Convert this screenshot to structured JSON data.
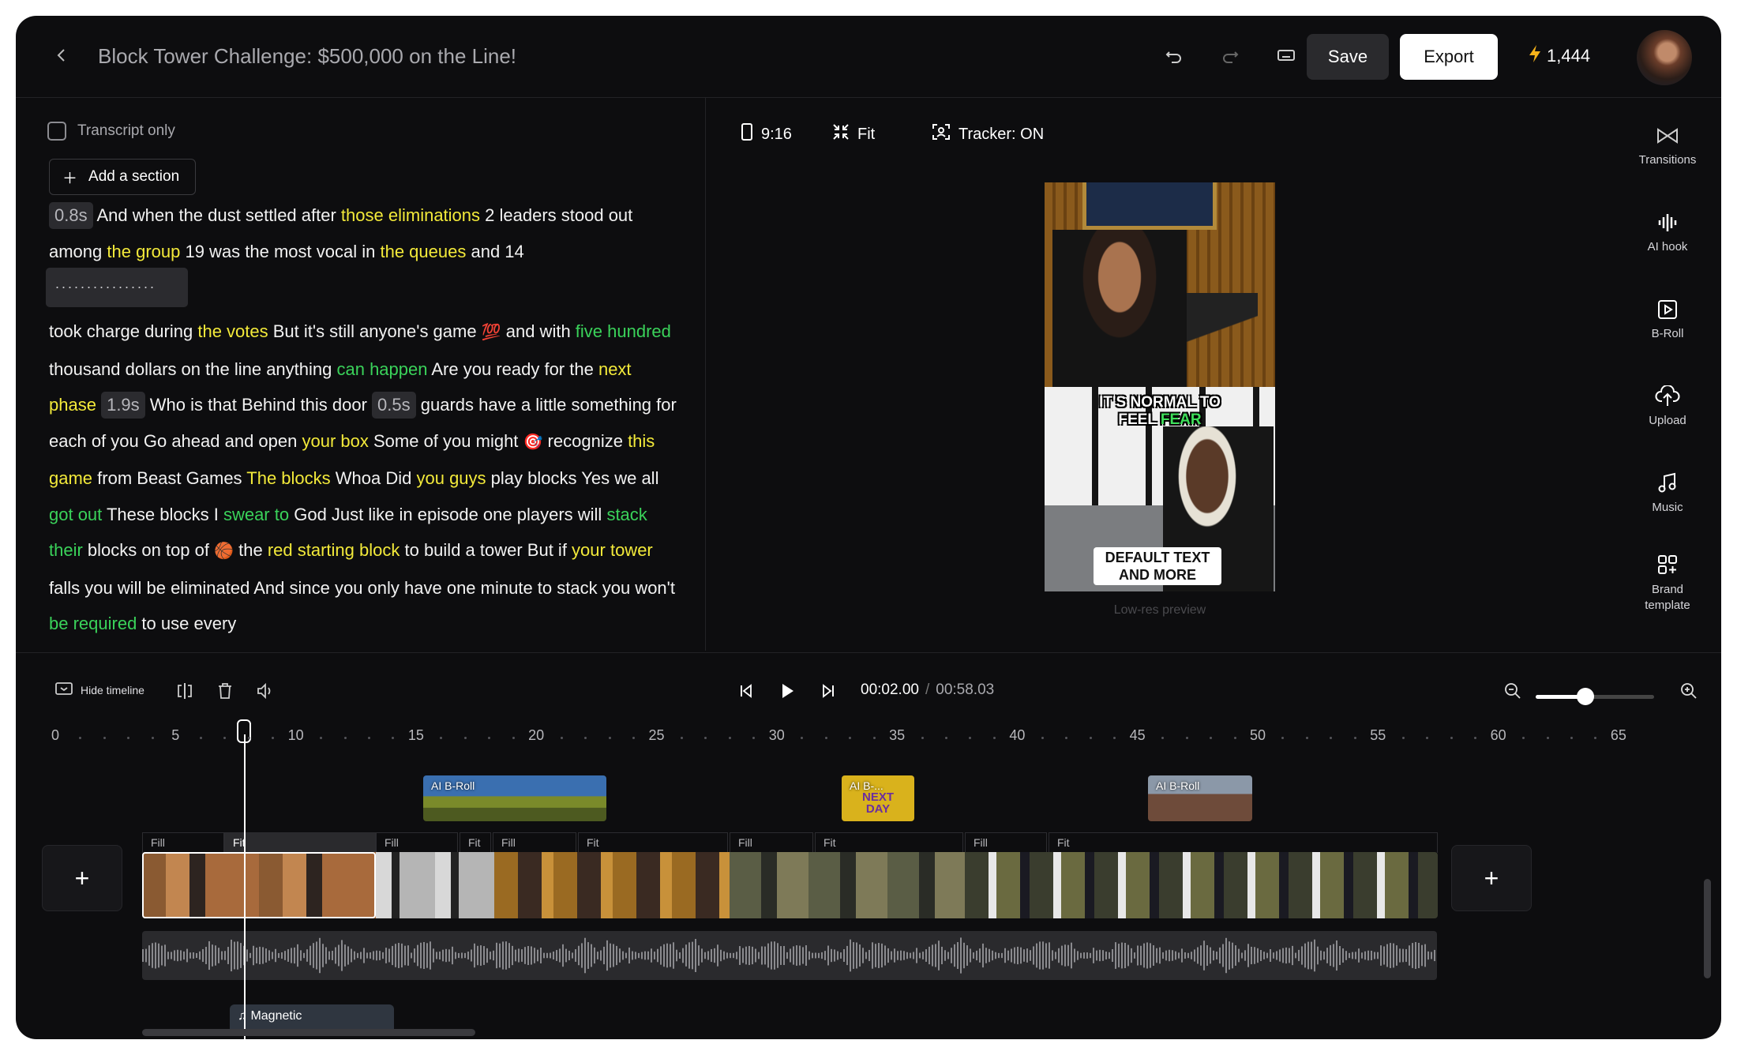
{
  "header": {
    "title": "Block Tower Challenge: $500,000 on the Line!",
    "save_label": "Save",
    "export_label": "Export",
    "credits": "1,444"
  },
  "transcript": {
    "transcript_only_label": "Transcript only",
    "add_section_label": "Add a section",
    "silence_dots": "................"
  },
  "preview": {
    "aspect_label": "9:16",
    "fit_label": "Fit",
    "tracker_label": "Tracker: ON",
    "caption_top_a": "IT'S NORMAL TO",
    "caption_top_b": "FEEL",
    "caption_top_c": "FEAR",
    "caption_bottom": "DEFAULT TEXT AND MORE",
    "lowres_label": "Low-res preview"
  },
  "sidebar": {
    "tools": [
      {
        "label": "Transitions",
        "icon": "transitions-icon"
      },
      {
        "label": "AI hook",
        "icon": "waveform-icon"
      },
      {
        "label": "B-Roll",
        "icon": "broll-icon"
      },
      {
        "label": "Upload",
        "icon": "upload-icon"
      },
      {
        "label": "Music",
        "icon": "music-icon"
      },
      {
        "label": "Brand template",
        "icon": "grid-icon"
      }
    ]
  },
  "timeline": {
    "hide_label": "Hide timeline",
    "current_time": "00:02.00",
    "separator": "/",
    "duration": "00:58.03",
    "zoom_level": 0.42,
    "ticks": [
      "0",
      "5",
      "10",
      "15",
      "20",
      "25",
      "30",
      "35",
      "40",
      "45",
      "50",
      "55",
      "60",
      "65"
    ],
    "broll_clips": [
      "AI B-Roll",
      "AI B-...",
      "AI B-Roll"
    ],
    "broll_mid_text": "NEXT DAY",
    "track_labels": [
      "Fill",
      "Fit",
      "Fill",
      "Fit",
      "Fill",
      "Fit",
      "Fill",
      "Fit",
      "Fill",
      "Fit"
    ],
    "music_label": "Magnetic"
  },
  "colors": {
    "highlight_yellow": "#f3ea3a",
    "highlight_green": "#3ad25a",
    "background": "#0d0d0f"
  }
}
